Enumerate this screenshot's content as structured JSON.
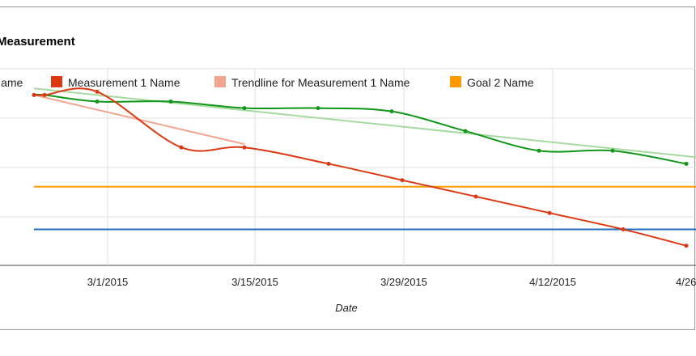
{
  "chart_data": {
    "type": "line",
    "title": "Measurement",
    "xlabel": "Date",
    "ylabel": "",
    "x_ticks": [
      "3/1/2015",
      "3/15/2015",
      "3/29/2015",
      "4/12/2015",
      "4/26"
    ],
    "legend": [
      {
        "name": "Name",
        "color": "#1f6fbf"
      },
      {
        "name": "Measurement 1 Name",
        "color": "#dc3912"
      },
      {
        "name": "Trendline for Measurement 1 Name",
        "color": "#f4a590"
      },
      {
        "name": "Goal 2 Name",
        "color": "#ff9900"
      }
    ],
    "legend_position": "top",
    "grid": true,
    "ylim": [
      0,
      5
    ],
    "series": [
      {
        "name": "Measurement 1 Name",
        "color": "#dc3912",
        "x": [
          "2/22/2015",
          "2/23/2015",
          "2/28/2015",
          "3/8/2015",
          "3/14/2015",
          "3/22/2015",
          "3/29/2015",
          "4/5/2015",
          "4/12/2015",
          "4/19/2015",
          "4/25/2015"
        ],
        "y": [
          4.6,
          4.6,
          4.65,
          3.8,
          3.8,
          3.55,
          3.3,
          3.05,
          2.8,
          2.55,
          2.3
        ]
      },
      {
        "color": "#109618",
        "x": [
          "2/22/2015",
          "2/23/2015",
          "2/28/2015",
          "3/7/2015",
          "3/14/2015",
          "3/21/2015",
          "3/28/2015",
          "4/4/2015",
          "4/11/2015",
          "4/18/2015",
          "4/25/2015"
        ],
        "y": [
          4.6,
          4.6,
          4.5,
          4.5,
          4.4,
          4.4,
          4.35,
          4.05,
          3.75,
          3.75,
          3.55
        ]
      },
      {
        "name": "Trendline for Measurement 1 Name",
        "color": "#f4a590",
        "x": [
          "2/22/2015",
          "3/14/2015"
        ],
        "y": [
          4.6,
          3.85
        ]
      },
      {
        "color": "#a6dba0",
        "x": [
          "2/22/2015",
          "4/26/2015"
        ],
        "y": [
          4.7,
          3.65
        ]
      },
      {
        "name": "Goal 2 Name",
        "color": "#ff9900",
        "x": [
          "2/22/2015",
          "4/26/2015"
        ],
        "y": [
          3.2,
          3.2
        ]
      },
      {
        "name": "Name",
        "color": "#1f6fbf",
        "x": [
          "2/22/2015",
          "4/26/2015"
        ],
        "y": [
          2.55,
          2.55
        ]
      }
    ]
  }
}
